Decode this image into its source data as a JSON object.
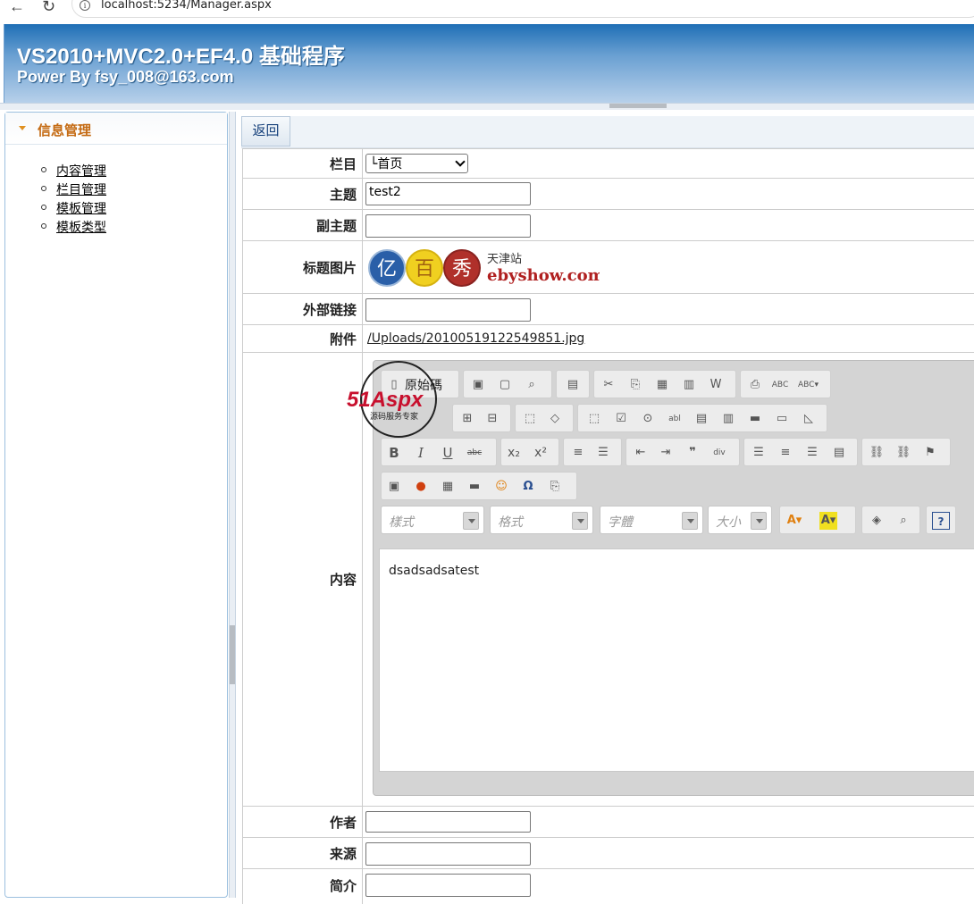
{
  "browser": {
    "url": "localhost:5234/Manager.aspx"
  },
  "header": {
    "title": "VS2010+MVC2.0+EF4.0 基础程序",
    "subtitle": "Power By fsy_008@163.com"
  },
  "sidebar": {
    "section_title": "信息管理",
    "items": [
      {
        "label": "内容管理"
      },
      {
        "label": "栏目管理"
      },
      {
        "label": "模板管理"
      },
      {
        "label": "模板类型"
      }
    ]
  },
  "main": {
    "back_label": "返回",
    "fields": {
      "column": {
        "label": "栏目",
        "value": "└首页"
      },
      "subject": {
        "label": "主题",
        "value": "test2"
      },
      "subtitle": {
        "label": "副主题",
        "value": ""
      },
      "title_image": {
        "label": "标题图片",
        "logo_text_cn": "天津站",
        "logo_text_en": "ebyshow.com",
        "logo_chars": [
          "亿",
          "百",
          "秀"
        ]
      },
      "external_link": {
        "label": "外部链接",
        "value": ""
      },
      "attachment": {
        "label": "附件",
        "value": "/Uploads/20100519122549851.jpg"
      },
      "content": {
        "label": "内容",
        "value": "dsadsadsatest"
      },
      "author": {
        "label": "作者",
        "value": ""
      },
      "source": {
        "label": "来源",
        "value": ""
      },
      "summary": {
        "label": "简介",
        "value": ""
      }
    }
  },
  "editor": {
    "source_label": "原始碼",
    "style_placeholder": "樣式",
    "format_placeholder": "格式",
    "font_placeholder": "字體",
    "size_placeholder": "大小"
  },
  "watermark": {
    "brand": "51Aspx",
    "tagline": "源码服务专家"
  }
}
